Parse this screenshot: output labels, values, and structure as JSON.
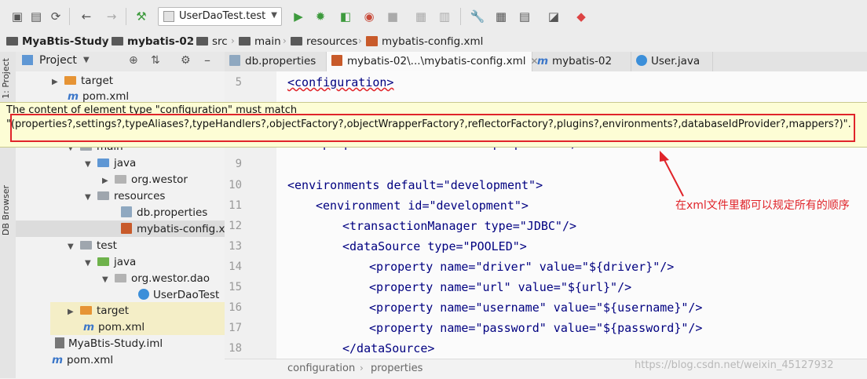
{
  "toolbar": {
    "run_config_label": "UserDaoTest.test",
    "icons": [
      "save-all-icon",
      "sync-icon",
      "back-icon",
      "forward-icon",
      "build-icon",
      "run-icon",
      "debug-icon",
      "coverage-icon",
      "profile-icon",
      "stop-icon",
      "settings-icon",
      "project-structure-icon",
      "sdk-icon",
      "vcs-icon"
    ]
  },
  "breadcrumb": [
    "MyaBtis-Study",
    "mybatis-02",
    "src",
    "main",
    "resources",
    "mybatis-config.xml"
  ],
  "project_panel": {
    "title": "Project",
    "tree": [
      {
        "label": "target"
      },
      {
        "label": "pom.xml"
      },
      {
        "label": "main"
      },
      {
        "label": "java"
      },
      {
        "label": "org.westor"
      },
      {
        "label": "resources"
      },
      {
        "label": "db.properties"
      },
      {
        "label": "mybatis-config.xm"
      },
      {
        "label": "test"
      },
      {
        "label": "java"
      },
      {
        "label": "org.westor.dao"
      },
      {
        "label": "UserDaoTest"
      },
      {
        "label": "target"
      },
      {
        "label": "pom.xml"
      },
      {
        "label": "MyaBtis-Study.iml"
      },
      {
        "label": "pom.xml"
      }
    ]
  },
  "side_tabs": {
    "project": "1: Project",
    "db": "DB Browser"
  },
  "tabs": [
    {
      "label": "db.properties"
    },
    {
      "label": "mybatis-02\\...\\mybatis-config.xml"
    },
    {
      "label": "mybatis-02"
    },
    {
      "label": "User.java"
    }
  ],
  "editor": {
    "lines": [
      {
        "n": "5",
        "text": "<configuration>"
      },
      {
        "n": "8",
        "text": "<properties resource=\"db.properties\"/>"
      },
      {
        "n": "9",
        "text": ""
      },
      {
        "n": "10",
        "text": "<environments default=\"development\">"
      },
      {
        "n": "11",
        "text": "<environment id=\"development\">"
      },
      {
        "n": "12",
        "text": "<transactionManager type=\"JDBC\"/>"
      },
      {
        "n": "13",
        "text": "<dataSource type=\"POOLED\">"
      },
      {
        "n": "14",
        "text": "<property name=\"driver\" value=\"${driver}\"/>"
      },
      {
        "n": "15",
        "text": "<property name=\"url\" value=\"${url}\"/>"
      },
      {
        "n": "16",
        "text": "<property name=\"username\" value=\"${username}\"/>"
      },
      {
        "n": "17",
        "text": "<property name=\"password\" value=\"${password}\"/>"
      },
      {
        "n": "18",
        "text": "</dataSource>"
      }
    ]
  },
  "tooltip": {
    "line1": "The content of element type \"configuration\" must match",
    "line2": "\"(properties?,settings?,typeAliases?,typeHandlers?,objectFactory?,objectWrapperFactory?,reflectorFactory?,plugins?,environments?,databaseIdProvider?,mappers?)\"."
  },
  "annotation": "在xml文件里都可以规定所有的顺序",
  "status_crumb": [
    "configuration",
    "properties"
  ],
  "watermark": "https://blog.csdn.net/weixin_45127932",
  "colors": {
    "annotation": "#e0242a",
    "tooltip_bg": "#fdfdd5"
  }
}
